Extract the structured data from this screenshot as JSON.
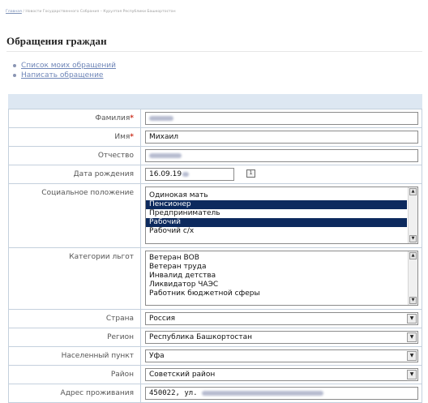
{
  "breadcrumb": {
    "items": [
      "Главная",
      "Новости Государственного Собрания – Курултая Республики Башкортостан"
    ],
    "separator": "/"
  },
  "page": {
    "title": "Обращения граждан"
  },
  "menu": [
    {
      "label": "Список моих обращений"
    },
    {
      "label": "Написать обращение"
    }
  ],
  "form": {
    "required_mark": "*",
    "last_name": {
      "label": "Фамилия"
    },
    "first_name": {
      "label": "Имя",
      "value": "Михаил"
    },
    "middle_name": {
      "label": "Отчество"
    },
    "birth_date": {
      "label": "Дата рождения",
      "value": "16.09.19"
    },
    "social_status": {
      "label": "Социальное положение",
      "options": [
        {
          "text": "Одинокая мать",
          "selected": false
        },
        {
          "text": "Пенсионер",
          "selected": true
        },
        {
          "text": "Предприниматель",
          "selected": false
        },
        {
          "text": "Рабочий",
          "selected": true
        },
        {
          "text": "Рабочий с/х",
          "selected": false
        }
      ]
    },
    "benefits": {
      "label": "Категории льгот",
      "options": [
        {
          "text": "Ветеран ВОВ",
          "selected": false
        },
        {
          "text": "Ветеран труда",
          "selected": false
        },
        {
          "text": "Инвалид детства",
          "selected": false
        },
        {
          "text": "Ликвидатор ЧАЭС",
          "selected": false
        },
        {
          "text": "Работник бюджетной сферы",
          "selected": false
        }
      ]
    },
    "country": {
      "label": "Страна",
      "value": "Россия"
    },
    "region": {
      "label": "Регион",
      "value": "Республика Башкортостан"
    },
    "settlement": {
      "label": "Населенный пункт",
      "value": "Уфа"
    },
    "district": {
      "label": "Район",
      "value": "Советский район"
    },
    "address": {
      "label": "Адрес проживания",
      "value": "450022, ул."
    }
  },
  "colors": {
    "selection": "#0d2a5e",
    "link": "#6f86b8",
    "border": "#c4d0dd",
    "header_band": "#dde7f2",
    "required": "#cc3322"
  },
  "icons": {
    "calendar": "calendar-icon",
    "dropdown": "chevron-down-icon",
    "scroll_up": "arrow-up-icon",
    "scroll_down": "arrow-down-icon",
    "bullet": "bullet-icon"
  }
}
